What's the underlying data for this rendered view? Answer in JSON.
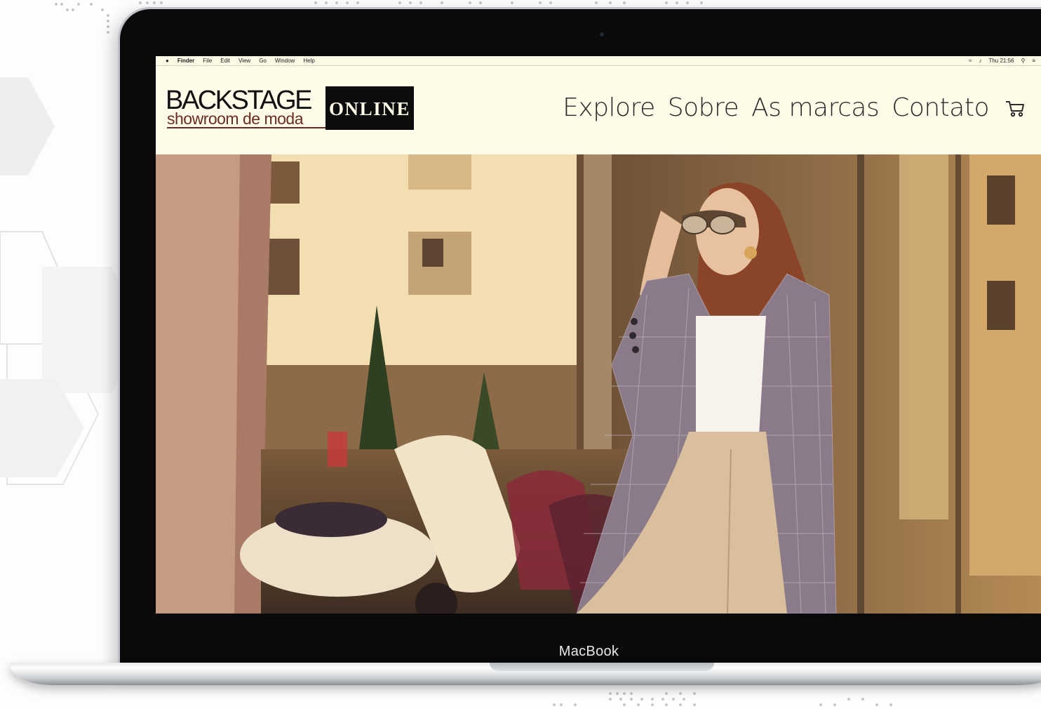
{
  "device": {
    "bezel_label": "MacBook"
  },
  "os_menubar": {
    "app_name": "Finder",
    "menus": [
      "File",
      "Edit",
      "View",
      "Go",
      "Window",
      "Help"
    ],
    "clock": "Thu 21:56"
  },
  "site": {
    "logo": {
      "brand": "BACKSTAGE",
      "tagline": "showroom de moda",
      "badge": "ONLINE"
    },
    "nav": {
      "items": [
        "Explore",
        "Sobre",
        "As marcas",
        "Contato"
      ],
      "cart_icon": "shopping-cart-icon"
    },
    "hero": {
      "image_icon": "fashion-model-photo"
    }
  },
  "colors": {
    "page_background": "#fefbe8",
    "logo_text": "#111111",
    "tagline": "#6b2a22",
    "badge_background": "#0c0c0c",
    "nav_text": "#2a2a2a"
  }
}
